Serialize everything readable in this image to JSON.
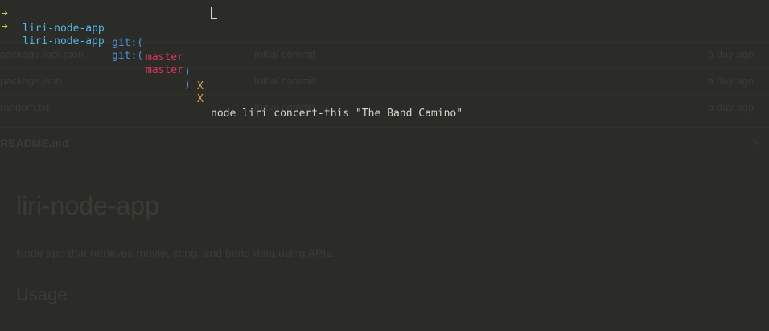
{
  "terminal": {
    "prev_line": {
      "arrow": "➜",
      "dir": "liri-node-app",
      "git": "git:(",
      "branch": "master",
      "git_close": ")",
      "dirty": "X"
    },
    "current_line": {
      "arrow": "➜",
      "dir": "liri-node-app",
      "git": "git:(",
      "branch": "master",
      "git_close": ")",
      "dirty": "X",
      "command": "node liri concert-this \"The Band Camino\""
    }
  },
  "background_page": {
    "files": [
      {
        "name": "",
        "message": "",
        "age": ""
      },
      {
        "name": "package-lock.json",
        "message": "Initial commit",
        "age": "a day ago"
      },
      {
        "name": "package.json",
        "message": "Initial commit",
        "age": "a day ago"
      },
      {
        "name": "random.txt",
        "message": "Initial commit",
        "age": "a day ago"
      }
    ],
    "readme_label": "README.md",
    "title": "liri-node-app",
    "description": "Node app that retrieves movie, song, and band data using APIs.",
    "usage_heading": "Usage"
  }
}
